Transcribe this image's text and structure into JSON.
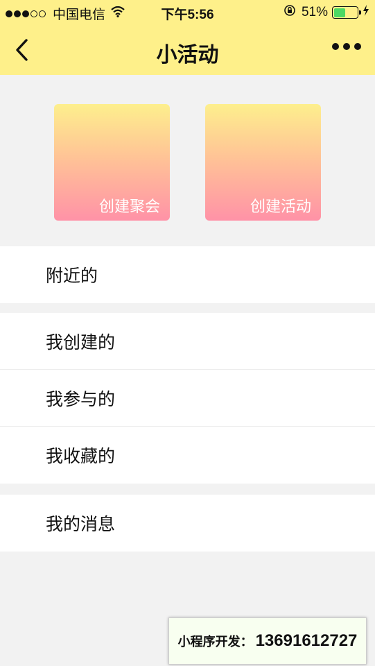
{
  "status_bar": {
    "carrier": "中国电信",
    "time": "下午5:56",
    "battery_percent": "51%",
    "battery_level": 0.51
  },
  "nav": {
    "title": "小活动"
  },
  "tiles": [
    {
      "label": "创建聚会"
    },
    {
      "label": "创建活动"
    }
  ],
  "lists": {
    "nearby": "附近的",
    "created": "我创建的",
    "joined": "我参与的",
    "favorites": "我收藏的",
    "messages": "我的消息"
  },
  "watermark": {
    "label": "小程序开发：",
    "phone": "13691612727"
  },
  "colors": {
    "nav_background": "#fef08a",
    "tile_top": "#fdef8d",
    "tile_bottom": "#ff92a7",
    "battery": "#4cd964"
  },
  "icons": [
    "wifi-icon",
    "orientation-lock-icon",
    "battery-icon",
    "charging-bolt-icon",
    "back-chevron-icon",
    "more-dots-icon"
  ]
}
